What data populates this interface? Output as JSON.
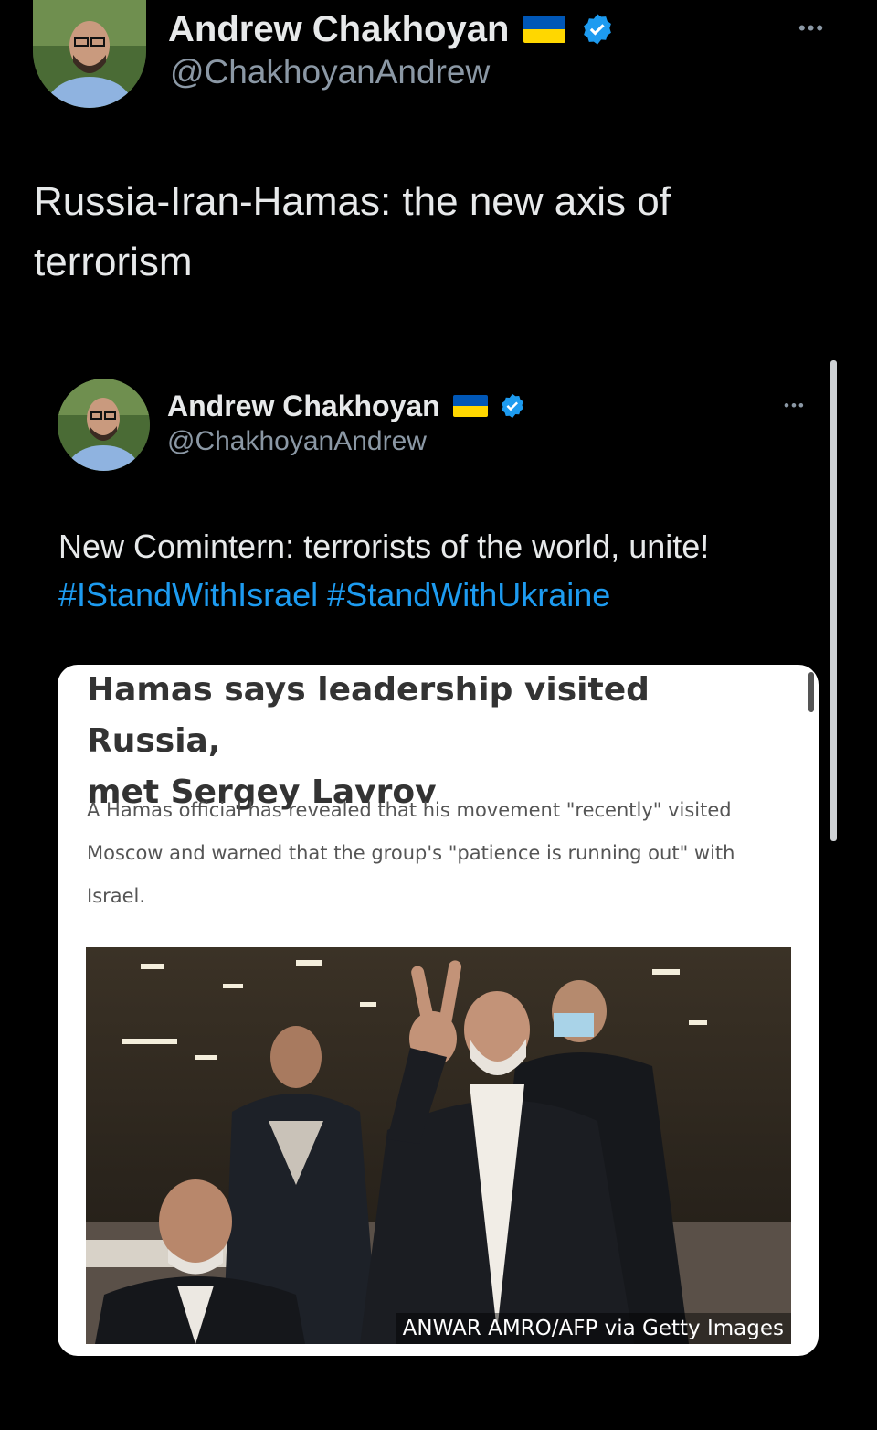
{
  "tweet": {
    "author": {
      "name": "Andrew Chakhoyan",
      "handle": "@ChakhoyanAndrew"
    },
    "more_label": "•••",
    "text": "Russia-Iran-Hamas: the new axis of terrorism"
  },
  "quoted": {
    "author": {
      "name": "Andrew Chakhoyan",
      "handle": "@ChakhoyanAndrew"
    },
    "more_label": "•••",
    "text": "New Comintern: terrorists of the world, unite!",
    "hashtags": [
      "#IStandWithIsrael",
      "#StandWithUkraine"
    ]
  },
  "article": {
    "headline_line1": "Hamas says leadership visited Russia,",
    "headline_line2": "met Sergey Lavrov",
    "summary_line1": "A Hamas official has revealed that his movement \"recently\" visited",
    "summary_line2": "Moscow and warned that the group's \"patience is running out\" with",
    "summary_line3": "Israel.",
    "photo_credit": "ANWAR AMRO/AFP via Getty Images"
  },
  "colors": {
    "background": "#000000",
    "link": "#1d9bf0",
    "verified": "#1d9bf0",
    "flag_blue": "#0057b7",
    "flag_yellow": "#ffd700"
  },
  "icons": [
    "verified-badge-icon",
    "ukraine-flag-icon",
    "more-options-icon"
  ]
}
